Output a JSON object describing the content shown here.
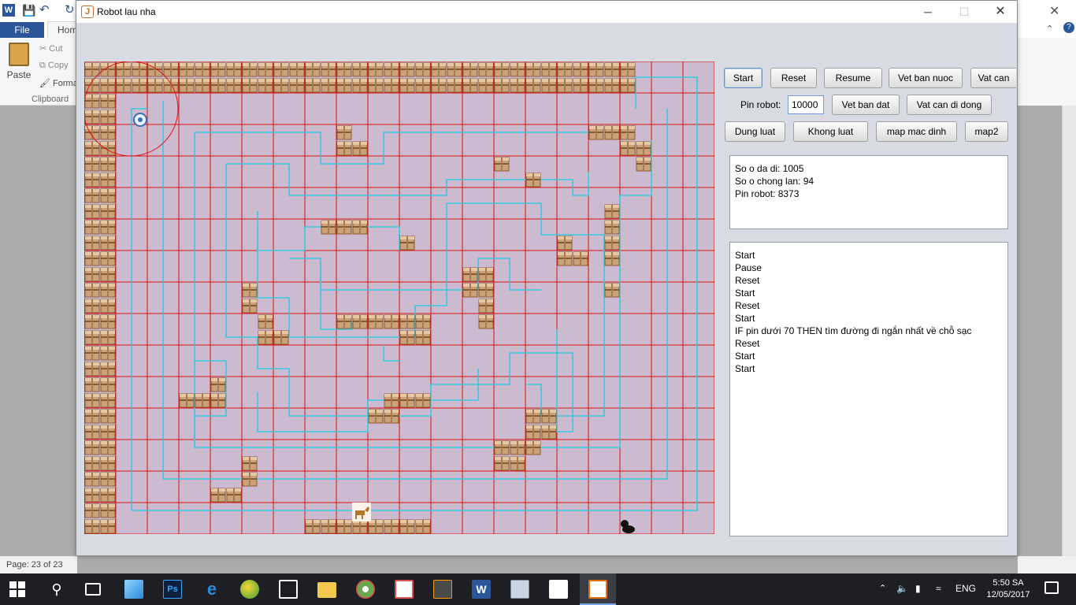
{
  "word": {
    "logo": "W",
    "file_tab": "File",
    "home_tab": "Hom",
    "paste": "Paste",
    "cut": "Cut",
    "copy": "Copy",
    "format": "Forma",
    "clipboard": "Clipboard",
    "status": "Page: 23 of 23"
  },
  "window": {
    "title": "Robot lau nha",
    "app_icon": "J",
    "min_icon": "─",
    "max_icon": "☐",
    "close_icon": "✕"
  },
  "controls": {
    "start": "Start",
    "reset": "Reset",
    "resume": "Resume",
    "vet_ban_nuoc": "Vet ban nuoc",
    "vat_can": "Vat can",
    "pin_label": "Pin robot:",
    "pin_value": "10000",
    "vet_ban_dat": "Vet ban dat",
    "vat_can_di_dong": "Vat can di dong",
    "dung_luat": "Dung luat",
    "khong_luat": "Khong  luat",
    "map_mac_dinh": "map mac dinh",
    "map2": "map2"
  },
  "stats": [
    "So o da di: 1005",
    "So o chong lan: 94",
    "Pin robot: 8373"
  ],
  "log": [
    "Start",
    "Pause",
    "Reset",
    "Start",
    "Reset",
    "Start",
    "IF pin dưới 70 THEN tìm đường đi ngắn nhất về chỗ sạc",
    "Reset",
    "Start",
    "Start"
  ],
  "grid": {
    "cols": 40,
    "rows": 30,
    "background": "#ccbad0",
    "grid_line_color": "#dd1111",
    "path_color": "#38c9dc",
    "box_colors": {
      "face": "#c9a27a",
      "band": "#8a5a34",
      "light": "#e6c9a4"
    },
    "boxes": [
      [
        0,
        0,
        34,
        0
      ],
      [
        0,
        1,
        34,
        1
      ],
      [
        0,
        2,
        1,
        29
      ],
      [
        16,
        4
      ],
      [
        16,
        5
      ],
      [
        17,
        5
      ],
      [
        32,
        4
      ],
      [
        33,
        4
      ],
      [
        34,
        4
      ],
      [
        34,
        5
      ],
      [
        35,
        5
      ],
      [
        35,
        6
      ],
      [
        26,
        6
      ],
      [
        28,
        7
      ],
      [
        15,
        10
      ],
      [
        16,
        10
      ],
      [
        17,
        10
      ],
      [
        20,
        11
      ],
      [
        33,
        9
      ],
      [
        33,
        10
      ],
      [
        33,
        11
      ],
      [
        33,
        12
      ],
      [
        30,
        11
      ],
      [
        30,
        12
      ],
      [
        31,
        12
      ],
      [
        33,
        14
      ],
      [
        24,
        13
      ],
      [
        25,
        13
      ],
      [
        24,
        14
      ],
      [
        25,
        14
      ],
      [
        25,
        15
      ],
      [
        25,
        16
      ],
      [
        10,
        14
      ],
      [
        10,
        15
      ],
      [
        11,
        16
      ],
      [
        11,
        17
      ],
      [
        12,
        17
      ],
      [
        16,
        16
      ],
      [
        17,
        16
      ],
      [
        18,
        16
      ],
      [
        19,
        16
      ],
      [
        20,
        16
      ],
      [
        21,
        16
      ],
      [
        20,
        17
      ],
      [
        21,
        17
      ],
      [
        8,
        20
      ],
      [
        6,
        21
      ],
      [
        7,
        21
      ],
      [
        8,
        21
      ],
      [
        19,
        21
      ],
      [
        20,
        21
      ],
      [
        21,
        21
      ],
      [
        18,
        22
      ],
      [
        19,
        22
      ],
      [
        28,
        22
      ],
      [
        29,
        22
      ],
      [
        28,
        23
      ],
      [
        29,
        23
      ],
      [
        26,
        24
      ],
      [
        27,
        24
      ],
      [
        28,
        24
      ],
      [
        26,
        25
      ],
      [
        27,
        25
      ],
      [
        10,
        25
      ],
      [
        10,
        26
      ],
      [
        8,
        27
      ],
      [
        9,
        27
      ],
      [
        14,
        29
      ],
      [
        15,
        29
      ],
      [
        16,
        29
      ],
      [
        17,
        29
      ],
      [
        18,
        29
      ],
      [
        19,
        29
      ],
      [
        20,
        29
      ],
      [
        21,
        29
      ]
    ],
    "paths": [
      [
        [
          3,
          28.5
        ],
        [
          3,
          3
        ],
        [
          4,
          3
        ]
      ],
      [
        [
          3,
          28.5
        ],
        [
          38.9,
          28.5
        ],
        [
          38.9,
          1
        ],
        [
          35,
          1
        ],
        [
          35,
          3
        ]
      ],
      [
        [
          5,
          2.5
        ],
        [
          5,
          26.5
        ],
        [
          37,
          26.5
        ],
        [
          37,
          3
        ]
      ],
      [
        [
          7,
          4.5
        ],
        [
          7,
          24.5
        ],
        [
          34,
          24.5
        ],
        [
          34,
          8.5
        ],
        [
          36,
          8.5
        ],
        [
          36,
          5
        ]
      ],
      [
        [
          7,
          4.5
        ],
        [
          15,
          4.5
        ],
        [
          15,
          6.5
        ],
        [
          19,
          6.5
        ],
        [
          19,
          4.5
        ],
        [
          32,
          4.5
        ]
      ],
      [
        [
          9,
          6.5
        ],
        [
          9,
          17.5
        ],
        [
          11,
          17.5
        ],
        [
          11,
          19.5
        ],
        [
          13,
          19.5
        ],
        [
          13,
          22.5
        ],
        [
          22,
          22.5
        ],
        [
          22,
          20.5
        ],
        [
          27,
          20.5
        ],
        [
          27,
          18.5
        ],
        [
          31,
          18.5
        ],
        [
          31,
          23.5
        ],
        [
          29,
          23.5
        ]
      ],
      [
        [
          9,
          6.5
        ],
        [
          13,
          6.5
        ],
        [
          13,
          8.5
        ],
        [
          23,
          8.5
        ],
        [
          23,
          7.5
        ],
        [
          31,
          7.5
        ],
        [
          31,
          8.5
        ],
        [
          32,
          8.5
        ],
        [
          32,
          7
        ]
      ],
      [
        [
          11,
          9.5
        ],
        [
          11,
          12
        ],
        [
          14,
          12
        ],
        [
          14,
          10.5
        ],
        [
          20,
          10.5
        ],
        [
          20,
          12
        ]
      ],
      [
        [
          11,
          10.5
        ],
        [
          11,
          15
        ],
        [
          13,
          15
        ],
        [
          13,
          17.5
        ],
        [
          21,
          17.5
        ],
        [
          21,
          15.5
        ],
        [
          23,
          15.5
        ],
        [
          23,
          9
        ]
      ],
      [
        [
          23,
          9
        ],
        [
          29,
          9
        ],
        [
          29,
          11
        ],
        [
          33,
          11
        ],
        [
          33,
          22.5
        ],
        [
          29,
          22.5
        ],
        [
          29,
          20.5
        ],
        [
          28,
          20.5
        ]
      ],
      [
        [
          13,
          12.5
        ],
        [
          15,
          12.5
        ],
        [
          15,
          14.5
        ],
        [
          25,
          14.5
        ],
        [
          25,
          12.5
        ],
        [
          27,
          12.5
        ],
        [
          27,
          14.5
        ],
        [
          29,
          14.5
        ]
      ],
      [
        [
          15,
          13
        ],
        [
          15,
          17
        ],
        [
          17,
          17
        ],
        [
          17,
          16.5
        ]
      ],
      [
        [
          19,
          18
        ],
        [
          19,
          19
        ],
        [
          20,
          19
        ]
      ],
      [
        [
          7,
          19
        ],
        [
          9,
          19
        ],
        [
          9,
          22.5
        ],
        [
          7,
          22.5
        ],
        [
          7,
          24.5
        ]
      ],
      [
        [
          11,
          21
        ],
        [
          11,
          23.5
        ],
        [
          18,
          23.5
        ],
        [
          18,
          21.5
        ],
        [
          25,
          21.5
        ],
        [
          25,
          19.5
        ]
      ],
      [
        [
          30,
          17
        ],
        [
          30,
          23.5
        ]
      ]
    ]
  }
}
